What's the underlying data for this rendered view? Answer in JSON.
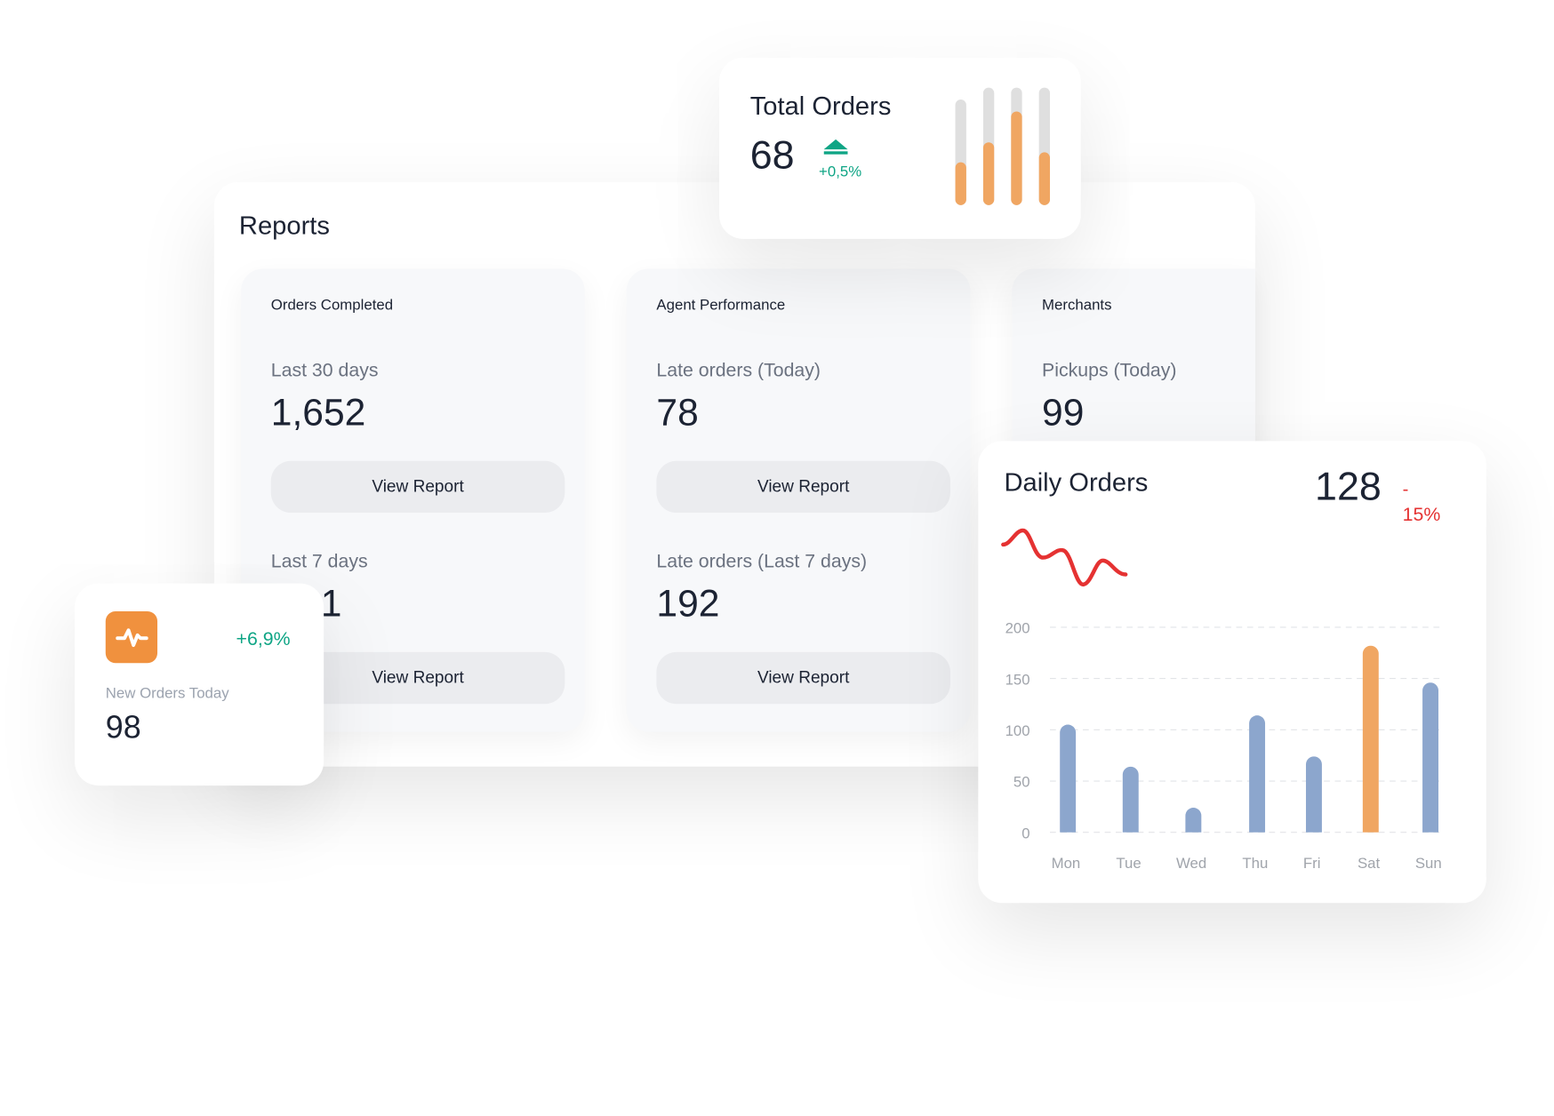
{
  "reports": {
    "title": "Reports",
    "sections": [
      {
        "heading": "Orders Completed",
        "items": [
          {
            "label": "Last 30 days",
            "value": "1,652",
            "button": "View Report"
          },
          {
            "label": "Last 7 days",
            "value": "1",
            "button": "View Report"
          }
        ]
      },
      {
        "heading": "Agent Performance",
        "items": [
          {
            "label": "Late orders (Today)",
            "value": "78",
            "button": "View Report"
          },
          {
            "label": "Late orders (Last 7 days)",
            "value": "192",
            "button": "View Report"
          }
        ]
      },
      {
        "heading": "Merchants",
        "items": [
          {
            "label": "Pickups (Today)",
            "value": "99"
          }
        ]
      }
    ]
  },
  "total_orders": {
    "title": "Total Orders",
    "value": "68",
    "change": "+0,5%",
    "trend_icon": "triangle-up-icon",
    "mini_bars": [
      0.41,
      0.53,
      0.8,
      0.45
    ],
    "colors": {
      "fill": "#f0a662",
      "track": "#dfdfdf",
      "up": "#0fa585"
    }
  },
  "new_orders": {
    "icon": "activity-pulse-icon",
    "change": "+6,9%",
    "label": "New Orders Today",
    "value": "98",
    "icon_color": "#f0913e"
  },
  "daily_orders": {
    "title": "Daily Orders",
    "value": "128",
    "change_sign": "-",
    "change": "15%",
    "sparkline_color": "#e53232"
  },
  "chart_data": {
    "type": "bar",
    "categories": [
      "Mon",
      "Tue",
      "Wed",
      "Thu",
      "Fri",
      "Sat",
      "Sun"
    ],
    "values": [
      105,
      64,
      24,
      114,
      74,
      182,
      146
    ],
    "highlight": "Sat",
    "yticks": [
      0,
      50,
      100,
      150,
      200
    ],
    "ylim": [
      0,
      200
    ],
    "grid": true,
    "colors": {
      "bar": "#8ca6cd",
      "highlight": "#f0a662"
    }
  }
}
